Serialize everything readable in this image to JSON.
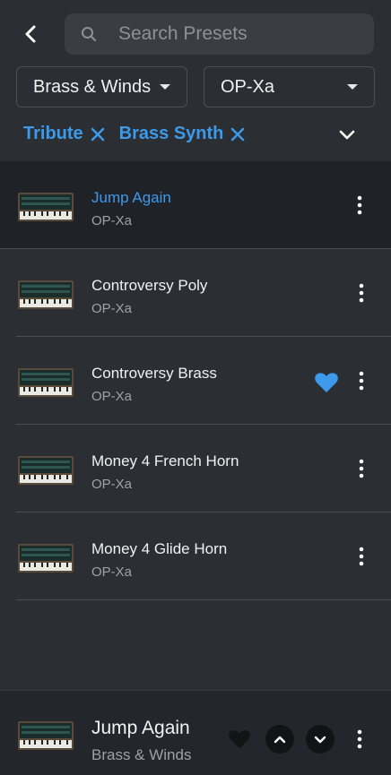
{
  "search": {
    "placeholder": "Search Presets"
  },
  "filters": {
    "category": "Brass & Winds",
    "instrument": "OP-Xa"
  },
  "chips": [
    {
      "label": "Tribute"
    },
    {
      "label": "Brass Synth"
    }
  ],
  "presets": [
    {
      "name": "Jump Again",
      "instrument": "OP-Xa",
      "selected": true,
      "favorite": false
    },
    {
      "name": "Controversy Poly",
      "instrument": "OP-Xa",
      "selected": false,
      "favorite": false
    },
    {
      "name": "Controversy Brass",
      "instrument": "OP-Xa",
      "selected": false,
      "favorite": true
    },
    {
      "name": "Money 4 French Horn",
      "instrument": "OP-Xa",
      "selected": false,
      "favorite": false
    },
    {
      "name": "Money 4 Glide Horn",
      "instrument": "OP-Xa",
      "selected": false,
      "favorite": false
    }
  ],
  "now_playing": {
    "name": "Jump Again",
    "category": "Brass & Winds"
  },
  "colors": {
    "accent": "#3d9aeb",
    "background": "#2b2e33",
    "selected_row": "#1f2226"
  },
  "icons": {
    "back": "chevron-left-icon",
    "search": "search-icon",
    "more": "more-vertical-icon",
    "heart": "heart-icon"
  }
}
